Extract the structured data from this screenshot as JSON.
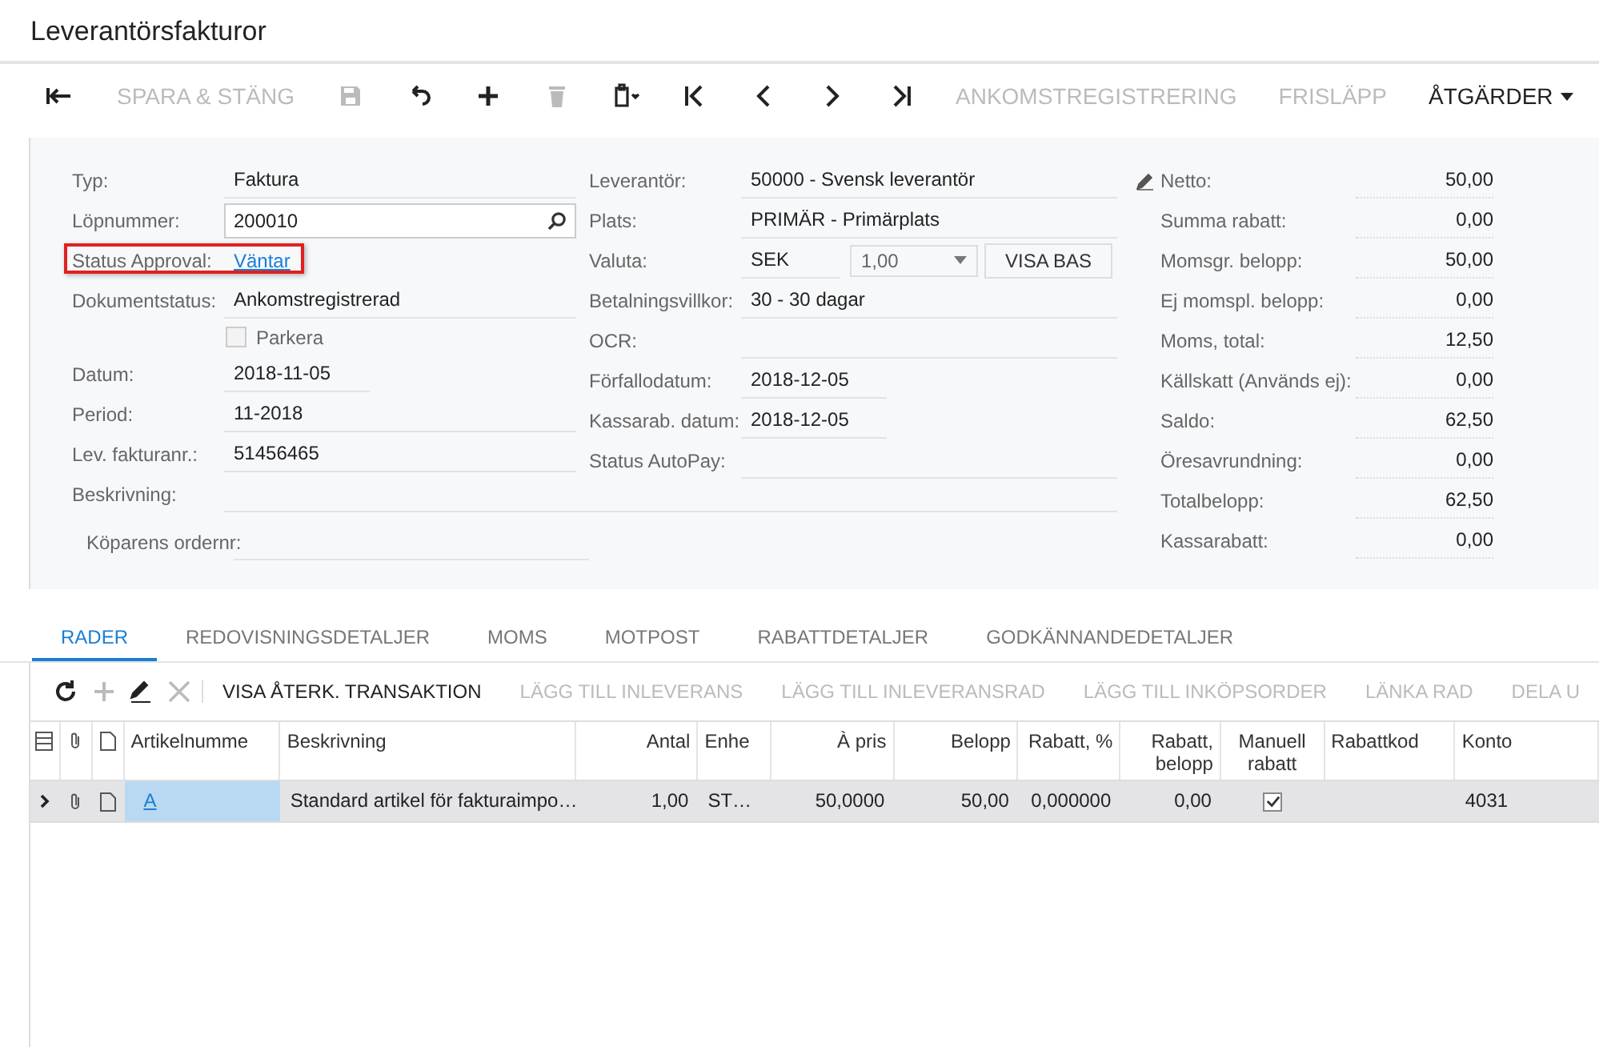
{
  "window": {
    "title": "Leverantörsfakturor"
  },
  "toolbar": [
    {
      "kind": "icon",
      "disabled": false
    },
    {
      "kind": "text",
      "label": "SPARA & STÄNG",
      "disabled": true
    },
    {
      "kind": "icon",
      "disabled": true
    },
    {
      "kind": "icon",
      "disabled": false
    },
    {
      "kind": "icon",
      "disabled": false
    },
    {
      "kind": "icon",
      "disabled": true
    },
    {
      "kind": "icon",
      "disabled": false
    },
    {
      "kind": "icon",
      "disabled": false
    },
    {
      "kind": "icon",
      "disabled": false
    },
    {
      "kind": "icon",
      "disabled": false
    },
    {
      "kind": "icon",
      "disabled": false
    },
    {
      "kind": "text",
      "label": "ANKOMSTREGISTRERING",
      "disabled": true
    },
    {
      "kind": "text",
      "label": "FRISLÄPP",
      "disabled": true
    },
    {
      "kind": "menu",
      "label": "ÅTGÄRDER",
      "disabled": false
    }
  ],
  "summary": {
    "left": [
      {
        "kind": "text",
        "label": "Typ:",
        "value": "Faktura"
      },
      {
        "kind": "lookup",
        "label": "Löpnummer:",
        "value": "200010"
      },
      {
        "kind": "link",
        "label": "Status Approval:",
        "value": "Väntar",
        "highlighted": true
      },
      {
        "kind": "text",
        "label": "Dokumentstatus:",
        "value": "Ankomstregistrerad"
      },
      {
        "kind": "checkbox",
        "label": "Parkera",
        "checked": false
      },
      {
        "kind": "date",
        "label": "Datum:",
        "value": "2018-11-05"
      },
      {
        "kind": "text",
        "label": "Period:",
        "value": "11-2018"
      },
      {
        "kind": "text",
        "label": "Lev. fakturanr.:",
        "value": "51456465"
      },
      {
        "kind": "wide",
        "label": "Beskrivning:"
      },
      {
        "kind": "indented",
        "label": "Köparens ordernr:"
      }
    ],
    "middle": [
      {
        "kind": "text",
        "label": "Leverantör:",
        "value": "50000 - Svensk leverantör"
      },
      {
        "kind": "text",
        "label": "Plats:",
        "value": "PRIMÄR - Primärplats"
      },
      {
        "kind": "currency",
        "label": "Valuta:",
        "value": "SEK",
        "rate": "1,00",
        "button": "VISA BAS"
      },
      {
        "kind": "text",
        "label": "Betalningsvillkor:",
        "value": "30 - 30 dagar"
      },
      {
        "kind": "text",
        "label": "OCR:"
      },
      {
        "kind": "date",
        "label": "Förfallodatum:",
        "value": "2018-12-05"
      },
      {
        "kind": "date",
        "label": "Kassarab. datum:",
        "value": "2018-12-05"
      },
      {
        "kind": "text",
        "label": "Status AutoPay:"
      }
    ],
    "totals": [
      {
        "label": "Netto:",
        "value": "50,00"
      },
      {
        "label": "Summa rabatt:",
        "value": "0,00"
      },
      {
        "label": "Momsgr. belopp:",
        "value": "50,00"
      },
      {
        "label": "Ej momspl. belopp:",
        "value": "0,00"
      },
      {
        "label": "Moms, total:",
        "value": "12,50"
      },
      {
        "label": "Källskatt (Används ej):",
        "value": "0,00"
      },
      {
        "label": "Saldo:",
        "value": "62,50"
      },
      {
        "label": "Öresavrundning:",
        "value": "0,00"
      },
      {
        "label": "Totalbelopp:",
        "value": "62,50"
      },
      {
        "label": "Kassarabatt:",
        "value": "0,00"
      }
    ]
  },
  "tabs": [
    {
      "label": "RADER",
      "selected": true
    },
    {
      "label": "REDOVISNINGSDETALJER",
      "selected": false
    },
    {
      "label": "MOMS",
      "selected": false
    },
    {
      "label": "MOTPOST",
      "selected": false
    },
    {
      "label": "RABATTDETALJER",
      "selected": false
    },
    {
      "label": "GODKÄNNANDEDETALJER",
      "selected": false
    }
  ],
  "grid_toolbar": [
    {
      "kind": "icon",
      "disabled": false
    },
    {
      "kind": "icon",
      "disabled": true
    },
    {
      "kind": "icon",
      "disabled": false
    },
    {
      "kind": "icon",
      "disabled": true
    },
    {
      "kind": "text",
      "label": "VISA ÅTERK. TRANSAKTION",
      "disabled": false
    },
    {
      "kind": "text",
      "label": "LÄGG TILL INLEVERANS",
      "disabled": true
    },
    {
      "kind": "text",
      "label": "LÄGG TILL INLEVERANSRAD",
      "disabled": true
    },
    {
      "kind": "text",
      "label": "LÄGG TILL INKÖPSORDER",
      "disabled": true
    },
    {
      "kind": "text",
      "label": "LÄNKA RAD",
      "disabled": true
    },
    {
      "kind": "text",
      "label": "DELA U",
      "disabled": true
    }
  ],
  "table": {
    "columns": [
      {
        "kind": "icon"
      },
      {
        "kind": "icon"
      },
      {
        "kind": "icon"
      },
      {
        "label": "Artikelnumme"
      },
      {
        "label": "Beskrivning"
      },
      {
        "label": "Antal"
      },
      {
        "label": "Enhe"
      },
      {
        "label": "À pris"
      },
      {
        "label": "Belopp"
      },
      {
        "label": "Rabatt, %"
      },
      {
        "label": "Rabatt, belopp"
      },
      {
        "label": "Manuell rabatt"
      },
      {
        "label": "Rabattkod"
      },
      {
        "label": "Konto"
      }
    ],
    "rows": [
      {
        "selected": true,
        "article": "A",
        "description": "Standard artikel för fakturaimpo…",
        "quantity": "1,00",
        "unit": "ST…",
        "unit_price": "50,0000",
        "amount": "50,00",
        "discount_percent": "0,000000",
        "discount_amount": "0,00",
        "manual_discount": true,
        "discount_code": "",
        "account": "4031"
      }
    ]
  }
}
